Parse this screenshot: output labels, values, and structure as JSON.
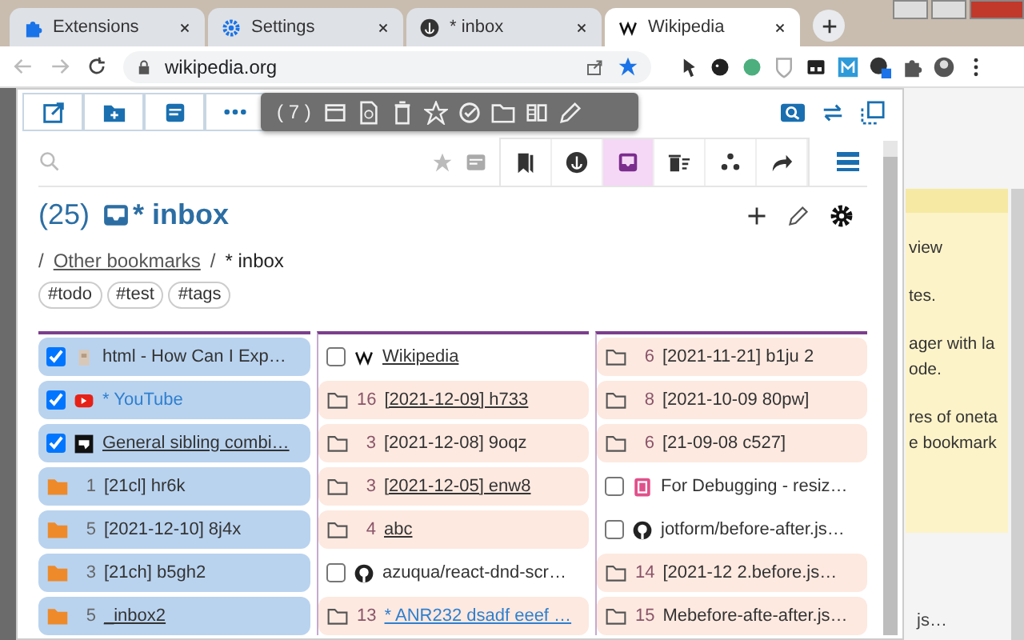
{
  "tabs": [
    {
      "title": "Extensions",
      "selected": false
    },
    {
      "title": "Settings",
      "selected": false
    },
    {
      "title": "* inbox",
      "selected": false
    },
    {
      "title": "Wikipedia",
      "selected": true
    }
  ],
  "address": "wikipedia.org",
  "popup": {
    "floating_bar": {
      "count": "( 7 )"
    },
    "views": [
      {
        "selected": false
      },
      {
        "selected": false
      },
      {
        "selected": true
      },
      {
        "selected": false
      },
      {
        "selected": false
      },
      {
        "selected": false
      }
    ],
    "title": {
      "count": "(25)",
      "name": "* inbox"
    },
    "breadcrumb": [
      {
        "separator": "/",
        "label": "Other bookmarks"
      },
      {
        "separator": "/",
        "label": "* inbox"
      }
    ],
    "tags": [
      "#todo",
      "#test",
      "#tags"
    ],
    "columns": [
      [
        {
          "kind": "bookmark",
          "selected": true,
          "checked": true,
          "title": "html - How Can I Exp…",
          "color": "#333333",
          "underlined": false
        },
        {
          "kind": "bookmark",
          "selected": true,
          "checked": true,
          "title": "* YouTube",
          "color": "#2f7fcf",
          "underlined": false
        },
        {
          "kind": "bookmark",
          "selected": true,
          "checked": true,
          "title": "General sibling combi…",
          "color": "#333333",
          "underlined": true
        },
        {
          "kind": "folder",
          "selected": true,
          "count": "1",
          "title": "[21cl] hr6k",
          "color": "#333333",
          "underlined": false
        },
        {
          "kind": "folder",
          "selected": true,
          "count": "5",
          "title": "[2021-12-10] 8j4x",
          "color": "#333333",
          "underlined": false
        },
        {
          "kind": "folder",
          "selected": true,
          "count": "3",
          "title": "[21ch] b5gh2",
          "color": "#333333",
          "underlined": false
        },
        {
          "kind": "folder",
          "selected": true,
          "count": "5",
          "title": "_inbox2",
          "color": "#333333",
          "underlined": true
        }
      ],
      [
        {
          "kind": "bookmark",
          "selected": false,
          "checked": false,
          "title": "Wikipedia",
          "color": "#333333",
          "underlined": true
        },
        {
          "kind": "folder",
          "selected": false,
          "count": "16",
          "title": "[2021-12-09] h733",
          "color": "#333333",
          "underlined": true
        },
        {
          "kind": "folder",
          "selected": false,
          "count": "3",
          "title": "[2021-12-08] 9oqz",
          "color": "#333333",
          "underlined": false
        },
        {
          "kind": "folder",
          "selected": false,
          "count": "3",
          "title": "[2021-12-05] enw8",
          "color": "#333333",
          "underlined": true
        },
        {
          "kind": "folder",
          "selected": false,
          "count": "4",
          "title": "abc",
          "color": "#333333",
          "underlined": true
        },
        {
          "kind": "bookmark",
          "selected": false,
          "checked": false,
          "title": "azuqua/react-dnd-scr…",
          "color": "#333333",
          "underlined": false
        },
        {
          "kind": "folder",
          "selected": false,
          "count": "13",
          "title": "* ANR232 dsadf eeef …",
          "color": "#2f7fcf",
          "underlined": true
        }
      ],
      [
        {
          "kind": "folder",
          "selected": false,
          "count": "6",
          "title": "[2021-11-21] b1ju 2",
          "color": "#333333",
          "underlined": false
        },
        {
          "kind": "folder",
          "selected": false,
          "count": "8",
          "title": "[2021-10-09 80pw]",
          "color": "#333333",
          "underlined": false
        },
        {
          "kind": "folder",
          "selected": false,
          "count": "6",
          "title": "[21-09-08 c527]",
          "color": "#333333",
          "underlined": false
        },
        {
          "kind": "bookmark",
          "selected": false,
          "checked": false,
          "title": "For Debugging - resiz…",
          "color": "#333333",
          "underlined": false
        },
        {
          "kind": "bookmark",
          "selected": false,
          "checked": false,
          "title": "jotform/before-after.js…",
          "color": "#333333",
          "underlined": false
        },
        {
          "kind": "folder",
          "selected": false,
          "count": "14",
          "title": "[2021-12 2.before.js…",
          "color": "#333333",
          "underlined": false
        },
        {
          "kind": "folder",
          "selected": false,
          "count": "15",
          "title": "Mebefore-afte-after.js…",
          "color": "#333333",
          "underlined": false
        }
      ]
    ]
  },
  "background_page": {
    "paragraphs": [
      [
        "view"
      ],
      [
        "tes."
      ],
      [
        "ager with la",
        "ode."
      ],
      [
        "res of oneta",
        "e bookmark"
      ]
    ],
    "footer": "js…"
  }
}
